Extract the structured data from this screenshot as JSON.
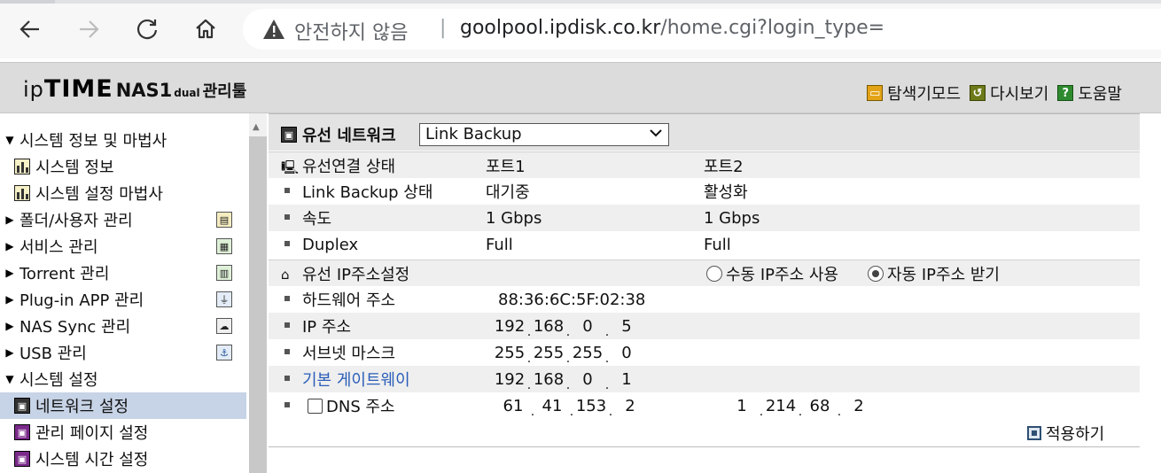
{
  "browser": {
    "security_label": "안전하지 않음",
    "separator": "|",
    "url_host": "goolpool.ipdisk.co.kr",
    "url_path": "/home.cgi?login_type="
  },
  "header": {
    "logo_ip": "ip",
    "logo_time": "TIME",
    "logo_nas": "NAS1",
    "logo_dual": "dual",
    "logo_tool": "관리툴",
    "links": [
      {
        "label": "탐색기모드",
        "icon": "folder-explore-icon"
      },
      {
        "label": "다시보기",
        "icon": "reload-icon"
      },
      {
        "label": "도움말",
        "icon": "help-icon"
      }
    ]
  },
  "sidebar": {
    "items": [
      {
        "label": "시스템 정보 및 마법사",
        "expanded": true
      },
      {
        "label": "시스템 정보"
      },
      {
        "label": "시스템 설정 마법사"
      },
      {
        "label": "폴더/사용자 관리",
        "expanded": false
      },
      {
        "label": "서비스 관리",
        "expanded": false
      },
      {
        "label": "Torrent 관리",
        "expanded": false
      },
      {
        "label": "Plug-in APP 관리",
        "expanded": false
      },
      {
        "label": "NAS Sync 관리",
        "expanded": false
      },
      {
        "label": "USB 관리",
        "expanded": false
      },
      {
        "label": "시스템 설정",
        "expanded": true
      },
      {
        "label": "네트워크 설정",
        "selected": true
      },
      {
        "label": "관리 페이지 설정"
      },
      {
        "label": "시스템 시간 설정"
      }
    ]
  },
  "main": {
    "section_title": "유선 네트워크",
    "mode_select": "Link Backup",
    "status_header": {
      "label": "유선연결 상태",
      "port1": "포트1",
      "port2": "포트2"
    },
    "status_rows": [
      {
        "label": "Link Backup 상태",
        "port1": "대기중",
        "port2": "활성화"
      },
      {
        "label": "속도",
        "port1": "1 Gbps",
        "port2": "1 Gbps"
      },
      {
        "label": "Duplex",
        "port1": "Full",
        "port2": "Full"
      }
    ],
    "ip_header": {
      "label": "유선 IP주소설정",
      "manual": "수동 IP주소 사용",
      "auto": "자동 IP주소 받기",
      "selected": "auto"
    },
    "hw_label": "하드웨어 주소",
    "hw_value": "88:36:6C:5F:02:38",
    "ip_label": "IP 주소",
    "ip": [
      "192",
      "168",
      "0",
      "5"
    ],
    "mask_label": "서브넷 마스크",
    "mask": [
      "255",
      "255",
      "255",
      "0"
    ],
    "gw_label": "기본 게이트웨이",
    "gw": [
      "192",
      "168",
      "0",
      "1"
    ],
    "dns_label": "DNS 주소",
    "dns_checked": false,
    "dns1": [
      "61",
      "41",
      "153",
      "2"
    ],
    "dns2": [
      "1",
      "214",
      "68",
      "2"
    ],
    "apply_label": "적용하기"
  }
}
